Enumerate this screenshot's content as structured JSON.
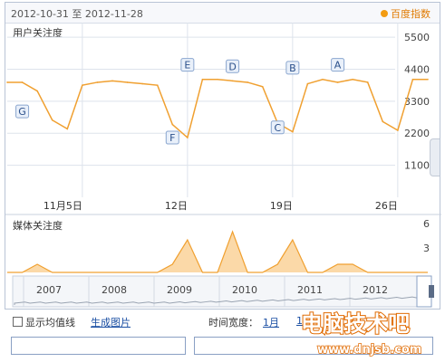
{
  "header": {
    "date_range": "2012-10-31 至 2012-11-28",
    "brand": "百度指数"
  },
  "colors": {
    "accent": "#f0a030",
    "fill": "#fbd9a8",
    "grid": "#dde3ec",
    "label_box_border": "#8aa6cf",
    "label_box_fill": "#e9f0fa"
  },
  "chart_data": [
    {
      "type": "line",
      "title": "用户关注度",
      "x": [
        "2012-10-31",
        "2012-11-01",
        "2012-11-02",
        "2012-11-03",
        "2012-11-04",
        "2012-11-05",
        "2012-11-06",
        "2012-11-07",
        "2012-11-08",
        "2012-11-09",
        "2012-11-10",
        "2012-11-11",
        "2012-11-12",
        "2012-11-13",
        "2012-11-14",
        "2012-11-15",
        "2012-11-16",
        "2012-11-17",
        "2012-11-18",
        "2012-11-19",
        "2012-11-20",
        "2012-11-21",
        "2012-11-22",
        "2012-11-23",
        "2012-11-24",
        "2012-11-25",
        "2012-11-26",
        "2012-11-27",
        "2012-11-28"
      ],
      "values": [
        3950,
        3950,
        3650,
        2650,
        2350,
        3850,
        3950,
        4000,
        3950,
        3900,
        3850,
        2500,
        2050,
        4050,
        4050,
        4000,
        3950,
        3800,
        2550,
        2250,
        3900,
        4050,
        3950,
        4050,
        3950,
        2600,
        2300,
        4050,
        4050
      ],
      "x_ticks": [
        {
          "x": "2012-11-05",
          "label": "11月5日"
        },
        {
          "x": "2012-11-12",
          "label": "12日"
        },
        {
          "x": "2012-11-19",
          "label": "19日"
        },
        {
          "x": "2012-11-26",
          "label": "26日"
        }
      ],
      "y_ticks": [
        1100,
        2200,
        3300,
        4400,
        5500
      ],
      "ylim": [
        0,
        6000
      ],
      "annotations": [
        {
          "label": "G",
          "x": "2012-11-01",
          "y": 2950
        },
        {
          "label": "F",
          "x": "2012-11-11",
          "y": 2050
        },
        {
          "label": "E",
          "x": "2012-11-12",
          "y": 4550
        },
        {
          "label": "D",
          "x": "2012-11-15",
          "y": 4500
        },
        {
          "label": "C",
          "x": "2012-11-18",
          "y": 2400
        },
        {
          "label": "B",
          "x": "2012-11-19",
          "y": 4450
        },
        {
          "label": "A",
          "x": "2012-11-22",
          "y": 4550
        }
      ]
    },
    {
      "type": "area",
      "title": "媒体关注度",
      "x": [
        "2012-10-31",
        "2012-11-01",
        "2012-11-02",
        "2012-11-03",
        "2012-11-04",
        "2012-11-05",
        "2012-11-06",
        "2012-11-07",
        "2012-11-08",
        "2012-11-09",
        "2012-11-10",
        "2012-11-11",
        "2012-11-12",
        "2012-11-13",
        "2012-11-14",
        "2012-11-15",
        "2012-11-16",
        "2012-11-17",
        "2012-11-18",
        "2012-11-19",
        "2012-11-20",
        "2012-11-21",
        "2012-11-22",
        "2012-11-23",
        "2012-11-24",
        "2012-11-25",
        "2012-11-26",
        "2012-11-27",
        "2012-11-28"
      ],
      "values": [
        0,
        0,
        1,
        0,
        0,
        0,
        0,
        0,
        0,
        0,
        0,
        1,
        4,
        0,
        0,
        5,
        0,
        0,
        1,
        4,
        0,
        0,
        1,
        1,
        0,
        0,
        0,
        0,
        0
      ],
      "y_ticks": [
        3,
        6
      ],
      "ylim": [
        0,
        6
      ]
    }
  ],
  "timeline": {
    "years": [
      "2007",
      "2008",
      "2009",
      "2010",
      "2011",
      "2012"
    ]
  },
  "controls": {
    "show_avg_label": "显示均值线",
    "gen_image_label": "生成图片",
    "time_width_label": "时间宽度：",
    "time_width_value": "1月",
    "time_width_next": "1"
  },
  "watermark": {
    "text": "电脑技术吧",
    "url": "www.dnjsb.com"
  }
}
